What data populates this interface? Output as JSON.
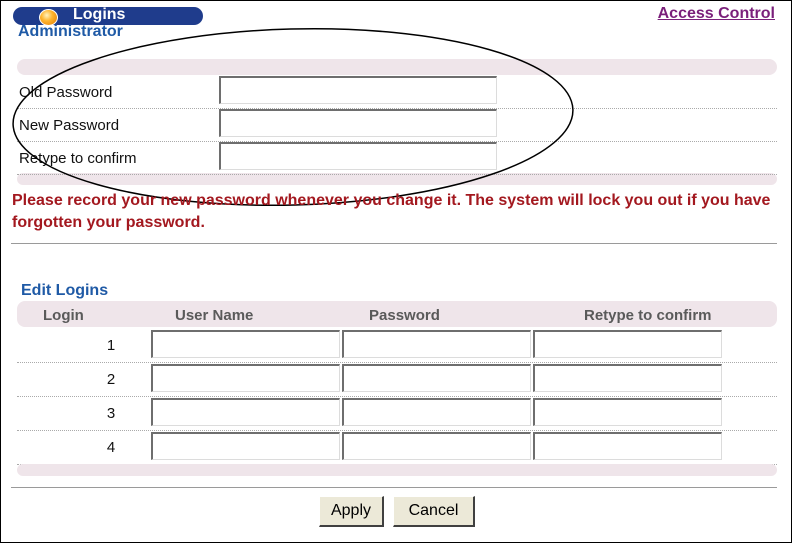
{
  "header": {
    "title": "Logins",
    "access_link": "Access Control"
  },
  "administrator": {
    "section_title": "Administrator",
    "fields": [
      {
        "label": "Old Password",
        "value": ""
      },
      {
        "label": "New Password",
        "value": ""
      },
      {
        "label": "Retype to confirm",
        "value": ""
      }
    ]
  },
  "warning_text": "Please record your new password whenever you change it. The system will lock you out if you have forgotten your password.",
  "edit_logins": {
    "section_title": "Edit Logins",
    "columns": [
      "Login",
      "User Name",
      "Password",
      "Retype to confirm"
    ],
    "rows": [
      {
        "login": "1",
        "user_name": "",
        "password": "",
        "retype": ""
      },
      {
        "login": "2",
        "user_name": "",
        "password": "",
        "retype": ""
      },
      {
        "login": "3",
        "user_name": "",
        "password": "",
        "retype": ""
      },
      {
        "login": "4",
        "user_name": "",
        "password": "",
        "retype": ""
      }
    ]
  },
  "buttons": {
    "apply": "Apply",
    "cancel": "Cancel"
  },
  "colors": {
    "title_bar": "#1f3c8c",
    "section_title": "#1f5aa6",
    "warning": "#a3181f",
    "access_link": "#7a1f7a",
    "band": "#efe5ea"
  },
  "annotation": "ellipse-around-administrator-fields"
}
